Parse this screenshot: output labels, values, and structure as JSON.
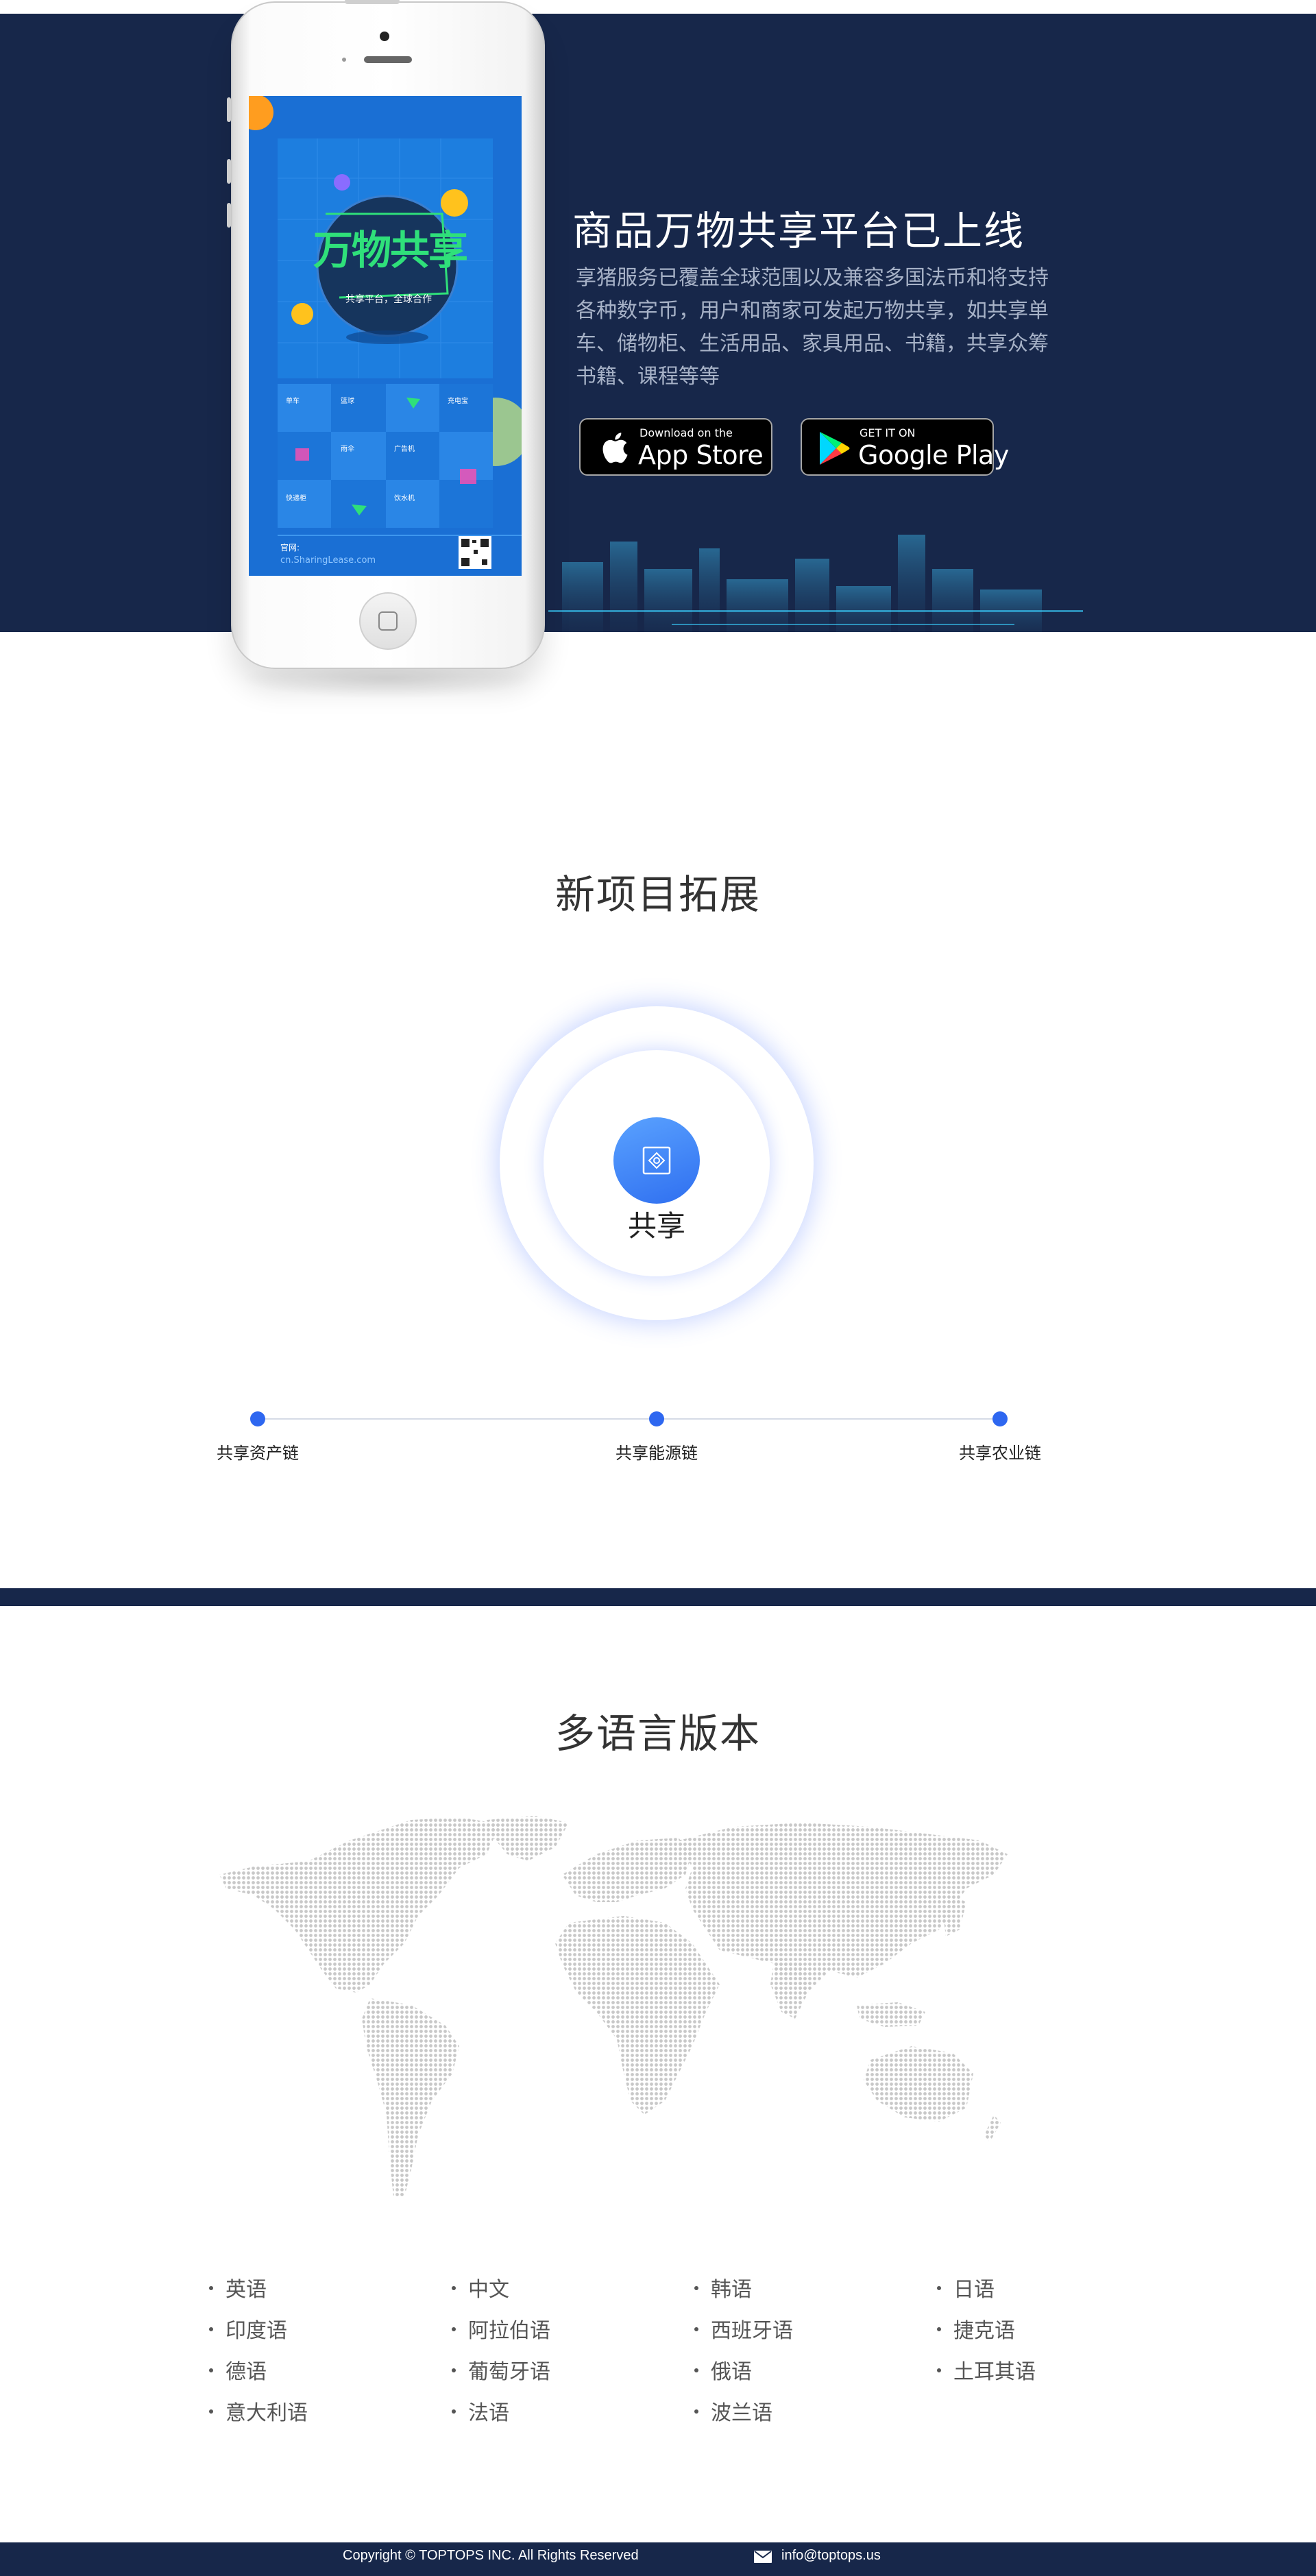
{
  "hero": {
    "title": "商品万物共享平台已上线",
    "description": "享猪服务已覆盖全球范围以及兼容多国法币和将支持各种数字币，用户和商家可发起万物共享，如共享单车、储物柜、生活用品、家具用品、书籍，共享众筹书籍、课程等等",
    "app_store": {
      "small": "Download on the",
      "big": "App Store"
    },
    "google_play": {
      "small": "GET IT ON",
      "big": "Google Play"
    }
  },
  "phone_screen": {
    "headline": "万物共享",
    "tagline": "共享平台，全球合作",
    "tiles": [
      "单车",
      "篮球",
      "充电宝",
      "雨伞",
      "广告机",
      "快递柜",
      "饮水机"
    ],
    "site_label": "官网:",
    "site_url": "cn.SharingLease.com"
  },
  "expansion": {
    "title": "新项目拓展",
    "core_label": "共享",
    "milestones": [
      "共享资产链",
      "共享能源链",
      "共享农业链"
    ]
  },
  "languages": {
    "title": "多语言版本",
    "columns": [
      [
        "英语",
        "印度语",
        "德语",
        "意大利语"
      ],
      [
        "中文",
        "阿拉伯语",
        "葡萄牙语",
        "法语"
      ],
      [
        "韩语",
        "西班牙语",
        "俄语",
        "波兰语"
      ],
      [
        "日语",
        "捷克语",
        "土耳其语"
      ]
    ]
  },
  "footer": {
    "copyright": "Copyright © TOPTOPS INC. All Rights Reserved",
    "email": "info@toptops.us"
  },
  "colors": {
    "navy": "#17274a",
    "accent_blue": "#2e67f0",
    "screen_blue": "#1a6fd4",
    "headline_green": "#2fe07a"
  }
}
